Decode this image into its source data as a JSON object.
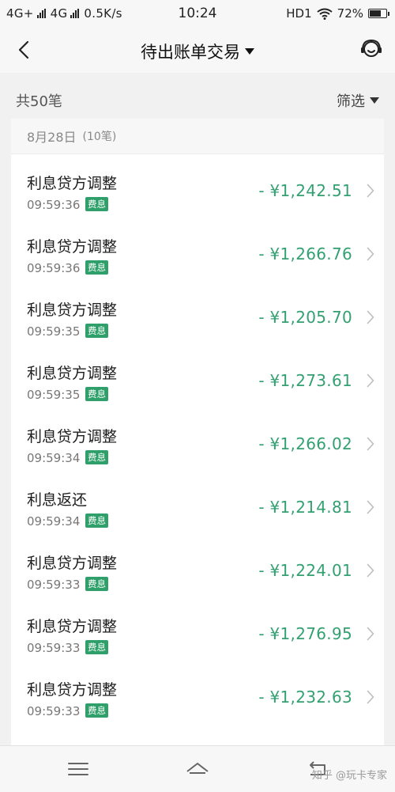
{
  "status_bar": {
    "net1": "4G+",
    "net2": "4G",
    "speed": "0.5K/s",
    "time": "10:24",
    "hd": "HD1",
    "battery": "72%",
    "battery_level": 0.72
  },
  "header": {
    "title": "待出账单交易",
    "back_icon": "chevron-left-icon",
    "service_icon": "customer-service-icon"
  },
  "summary": {
    "total": "共50笔",
    "filter_label": "筛选"
  },
  "group": {
    "date": "8月28日",
    "count": "(10笔)"
  },
  "transactions": [
    {
      "title": "利息贷方调整",
      "time": "09:59:36",
      "badge": "费息",
      "amount": "- ¥1,242.51"
    },
    {
      "title": "利息贷方调整",
      "time": "09:59:36",
      "badge": "费息",
      "amount": "- ¥1,266.76"
    },
    {
      "title": "利息贷方调整",
      "time": "09:59:35",
      "badge": "费息",
      "amount": "- ¥1,205.70"
    },
    {
      "title": "利息贷方调整",
      "time": "09:59:35",
      "badge": "费息",
      "amount": "- ¥1,273.61"
    },
    {
      "title": "利息贷方调整",
      "time": "09:59:34",
      "badge": "费息",
      "amount": "- ¥1,266.02"
    },
    {
      "title": "利息返还",
      "time": "09:59:34",
      "badge": "费息",
      "amount": "- ¥1,214.81"
    },
    {
      "title": "利息贷方调整",
      "time": "09:59:33",
      "badge": "费息",
      "amount": "- ¥1,224.01"
    },
    {
      "title": "利息贷方调整",
      "time": "09:59:33",
      "badge": "费息",
      "amount": "- ¥1,276.95"
    },
    {
      "title": "利息贷方调整",
      "time": "09:59:33",
      "badge": "费息",
      "amount": "- ¥1,232.63"
    }
  ],
  "nav": {
    "menu_icon": "menu-icon",
    "home_icon": "home-icon",
    "back_icon": "return-icon"
  },
  "watermark": "知乎 @玩卡专家",
  "colors": {
    "amount": "#33a071",
    "badge": "#2fa06a"
  }
}
